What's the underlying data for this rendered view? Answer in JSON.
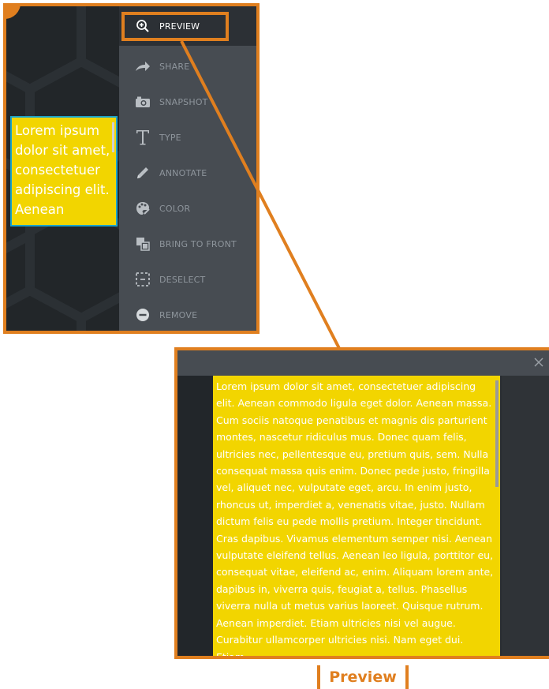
{
  "colors": {
    "accent": "#e07f1f",
    "note_fill": "#f2d500",
    "selection_border": "#1aa3c9",
    "menu_bg": "#474c52",
    "canvas_bg": "#222629"
  },
  "note_text": "Lorem ipsum dolor sit amet, consectetuer adipiscing elit. Aenean",
  "context_menu": {
    "items": [
      {
        "label": "PREVIEW",
        "icon": "zoom-in-icon"
      },
      {
        "label": "SHARE",
        "icon": "share-arrow-icon"
      },
      {
        "label": "SNAPSHOT",
        "icon": "camera-icon"
      },
      {
        "label": "TYPE",
        "icon": "text-type-icon"
      },
      {
        "label": "ANNOTATE",
        "icon": "pencil-icon"
      },
      {
        "label": "COLOR",
        "icon": "palette-icon"
      },
      {
        "label": "BRING TO FRONT",
        "icon": "bring-to-front-icon"
      },
      {
        "label": "DESELECT",
        "icon": "deselect-icon"
      },
      {
        "label": "REMOVE",
        "icon": "remove-icon"
      }
    ]
  },
  "preview_window": {
    "close_icon": "close-icon",
    "text": "Lorem ipsum dolor sit amet, consectetuer adipiscing elit. Aenean commodo ligula eget dolor. Aenean massa. Cum sociis natoque penatibus et magnis dis parturient montes, nascetur ridiculus mus. Donec quam felis, ultricies nec, pellentesque eu, pretium quis, sem. Nulla consequat massa quis enim. Donec pede justo, fringilla vel, aliquet nec, vulputate eget, arcu. In enim justo, rhoncus ut, imperdiet a, venenatis vitae, justo. Nullam dictum felis eu pede mollis pretium. Integer tincidunt. Cras dapibus. Vivamus elementum semper nisi. Aenean vulputate eleifend tellus. Aenean leo ligula, porttitor eu, consequat vitae, eleifend ac, enim. Aliquam lorem ante, dapibus in, viverra quis, feugiat a, tellus. Phasellus viverra nulla ut metus varius laoreet. Quisque rutrum. Aenean imperdiet. Etiam ultricies nisi vel augue. Curabitur ullamcorper ultricies nisi. Nam eget dui. Etiam"
  },
  "caption": "Preview"
}
